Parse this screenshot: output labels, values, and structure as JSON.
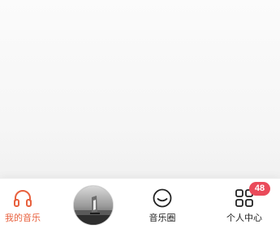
{
  "tabbar": {
    "my_music": {
      "label": "我的音乐",
      "icon": "headphones-icon",
      "color": "#e8613e",
      "active": true
    },
    "player": {
      "icon": "album-art"
    },
    "music_circle": {
      "label": "音乐圈",
      "icon": "smile-icon"
    },
    "me": {
      "label": "个人中心",
      "icon": "grid-icon",
      "badge": "48",
      "badge_color": "#ea4a5a"
    }
  }
}
